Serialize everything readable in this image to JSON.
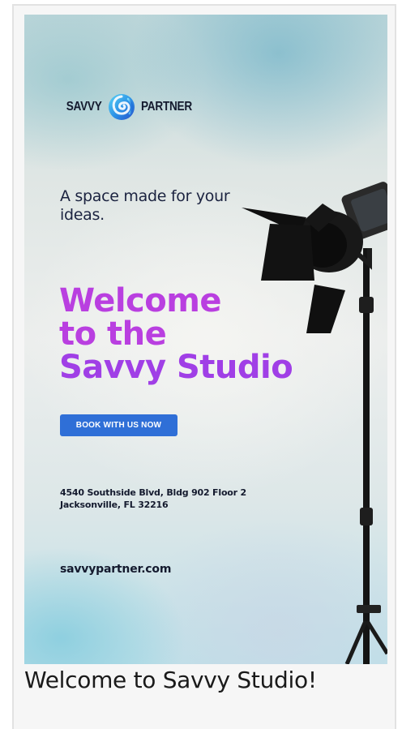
{
  "poster": {
    "logo": {
      "left_word": "SAVVY",
      "right_word": "PARTNER",
      "mark_icon": "savvy-partner-swirl-icon"
    },
    "tagline": "A space made for your ideas.",
    "headline": {
      "line1": "Welcome",
      "line2": "to the",
      "line3": "Savvy Studio"
    },
    "cta_label": "BOOK WITH US NOW",
    "address": {
      "line1": "4540 Southside Blvd, Bldg 902 Floor 2",
      "line2": "Jacksonville, FL 32216"
    },
    "website": "savvypartner.com",
    "image_subject": "studio-light-icon"
  },
  "caption": "Welcome to Savvy Studio!",
  "colors": {
    "headline": "#b93fe0",
    "cta_background": "#2f6fd7",
    "text_dark": "#141a2e"
  }
}
